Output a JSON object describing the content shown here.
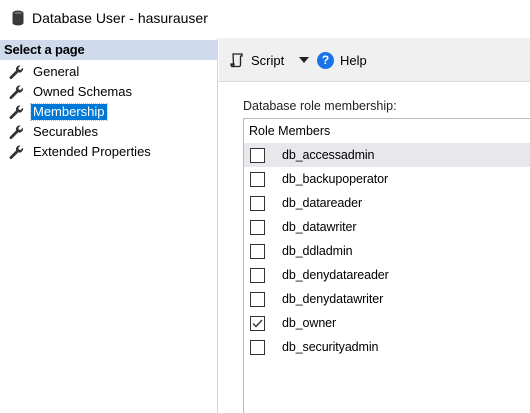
{
  "window": {
    "title": "Database User - hasurauser"
  },
  "sidebar": {
    "header": "Select a page",
    "items": [
      {
        "label": "General",
        "selected": false
      },
      {
        "label": "Owned Schemas",
        "selected": false
      },
      {
        "label": "Membership",
        "selected": true
      },
      {
        "label": "Securables",
        "selected": false
      },
      {
        "label": "Extended Properties",
        "selected": false
      }
    ]
  },
  "toolbar": {
    "script_label": "Script",
    "help_label": "Help"
  },
  "membership": {
    "section_label": "Database role membership:",
    "column_header": "Role Members",
    "roles": [
      {
        "name": "db_accessadmin",
        "checked": false
      },
      {
        "name": "db_backupoperator",
        "checked": false
      },
      {
        "name": "db_datareader",
        "checked": false
      },
      {
        "name": "db_datawriter",
        "checked": false
      },
      {
        "name": "db_ddladmin",
        "checked": false
      },
      {
        "name": "db_denydatareader",
        "checked": false
      },
      {
        "name": "db_denydatawriter",
        "checked": false
      },
      {
        "name": "db_owner",
        "checked": true
      },
      {
        "name": "db_securityadmin",
        "checked": false
      }
    ]
  },
  "colors": {
    "accent": "#0078d7",
    "sidebar_header": "#cfdbed",
    "toolbar_bg": "#f0f0f0",
    "help_blue": "#1a73e8"
  }
}
